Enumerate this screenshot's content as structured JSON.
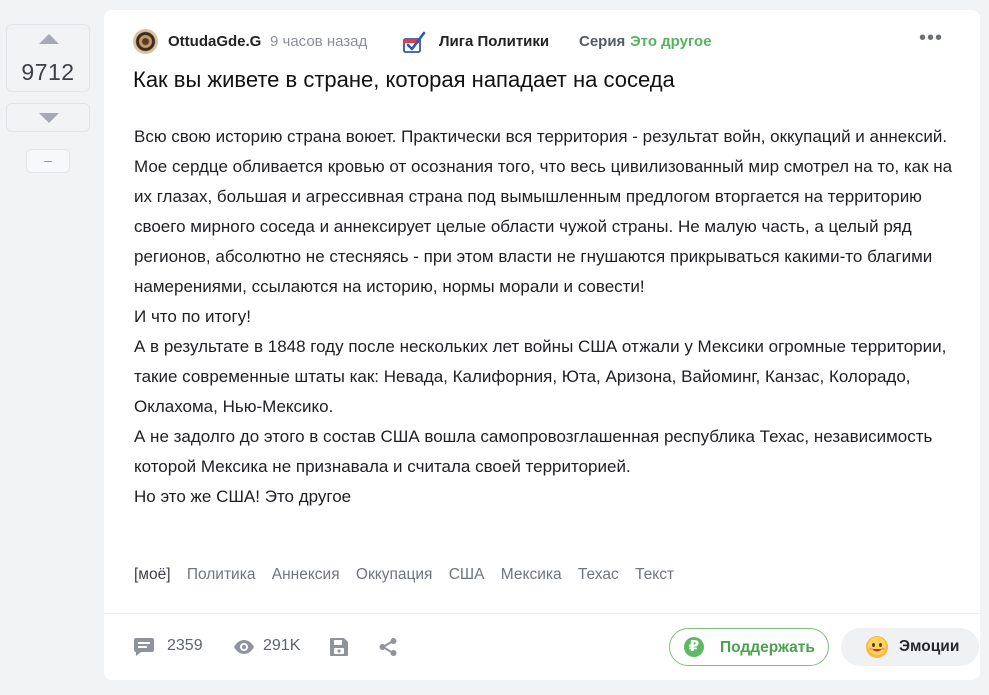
{
  "vote": {
    "score": "9712",
    "hide_label": "–"
  },
  "post": {
    "author": "OttudaGde.G",
    "time": "9 часов назад",
    "community": "Лига Политики",
    "series_label": "Серия",
    "series_value": "Это другое",
    "more_label": "•••",
    "title": "Как вы живете в стране, которая нападает на соседа",
    "paragraphs": [
      "Всю свою историю страна воюет. Практически вся территория - результат войн, оккупаций и аннексий.",
      "Мое сердце обливается кровью от осознания того, что весь цивилизованный мир смотрел на то, как на их глазах, большая и агрессивная страна под вымышленным предлогом вторгается на территорию своего мирного соседа и аннексирует целые области чужой страны. Не малую часть, а целый ряд регионов, абсолютно не стесняясь - при этом власти не гнушаются прикрываться какими-то благими намерениями, ссылаются на историю, нормы морали и совести!",
      "И что по итогу!",
      "А в результате в 1848 году после нескольких лет войны США отжали у Мексики огромные территории, такие современные штаты как: Невада, Калифорния, Юта, Аризона, Вайоминг, Канзас, Колорадо, Оклахома, Нью-Мексико.",
      "А не задолго до этого в состав США вошла самопровозглашенная республика Техас, независимость которой Мексика не признавала и считала своей территорией.",
      "Но это же США! Это другое"
    ],
    "tags": [
      "[моё]",
      "Политика",
      "Аннексия",
      "Оккупация",
      "США",
      "Мексика",
      "Техас",
      "Текст"
    ]
  },
  "footer": {
    "comments": "2359",
    "views": "291K",
    "support_label": "Поддержать",
    "support_symbol": "₽",
    "emotions_label": "Эмоции"
  }
}
